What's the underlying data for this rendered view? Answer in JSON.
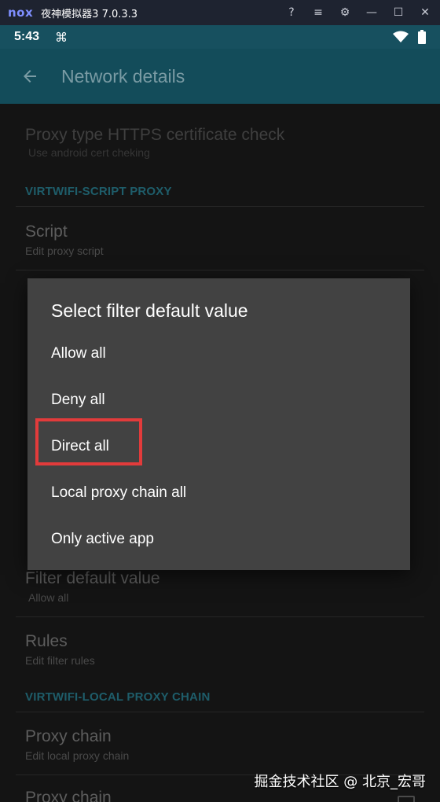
{
  "emulator": {
    "logo": "nox",
    "title": "夜神模拟器3 7.0.3.3",
    "controls": [
      {
        "name": "help-icon",
        "glyph": "?"
      },
      {
        "name": "menu-icon",
        "glyph": "≡"
      },
      {
        "name": "settings-icon",
        "glyph": "⚙"
      },
      {
        "name": "minimize-icon",
        "glyph": "—"
      },
      {
        "name": "maximize-icon",
        "glyph": "☐"
      },
      {
        "name": "close-icon",
        "glyph": "✕"
      }
    ]
  },
  "status_bar": {
    "time": "5:43",
    "command_glyph": "⌘"
  },
  "toolbar": {
    "title": "Network details"
  },
  "list": {
    "proxy_type_cert": {
      "title": "Proxy type HTTPS certificate check",
      "summary": "Use android cert cheking"
    },
    "category_script": "VIRTWIFI-SCRIPT PROXY",
    "script": {
      "title": "Script",
      "summary": "Edit proxy script"
    },
    "filter_default": {
      "title": "Filter default value",
      "summary": "Allow all"
    },
    "rules": {
      "title": "Rules",
      "summary": "Edit filter rules"
    },
    "category_local_chain": "VIRTWIFI-LOCAL PROXY CHAIN",
    "proxy_chain": {
      "title": "Proxy chain",
      "summary": "Edit local proxy chain"
    },
    "proxy_chain_2": {
      "title": "Proxy chain"
    }
  },
  "dialog": {
    "title": "Select filter default value",
    "options": [
      "Allow all",
      "Deny all",
      "Direct all",
      "Local proxy chain all",
      "Only active app"
    ],
    "highlighted_option": "Direct all"
  },
  "watermark": "掘金技术社区 @ 北京_宏哥",
  "colors": {
    "accent": "#17505f",
    "dialog_bg": "#424242",
    "highlight": "#e23b3b"
  }
}
